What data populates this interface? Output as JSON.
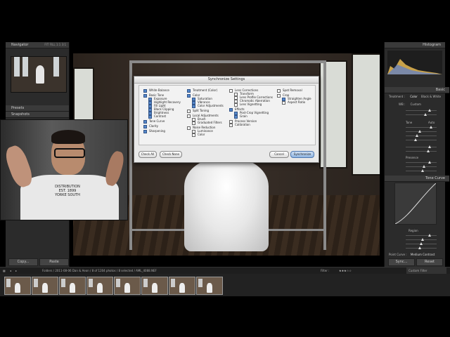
{
  "left_panel": {
    "navigator": {
      "title": "Navigator",
      "zoom_options": [
        "FIT",
        "FILL",
        "1:1",
        "3:1"
      ]
    },
    "presets": "Presets",
    "snapshots": "Snapshots",
    "copy_label": "Copy...",
    "paste_label": "Paste"
  },
  "right_panel": {
    "histogram_title": "Histogram",
    "basic_title": "Basic",
    "treatment": {
      "label": "Treatment :",
      "color": "Color",
      "bw": "Black & White"
    },
    "wb": {
      "label": "WB :",
      "value": "Custom"
    },
    "tone_label": "Tone",
    "auto_label": "Auto",
    "presence_label": "Presence",
    "tone_curve_title": "Tone Curve",
    "region_label": "Region",
    "point_curve": {
      "label": "Point Curve :",
      "value": "Medium Contrast"
    },
    "sync_label": "Sync...",
    "reset_label": "Reset"
  },
  "dialog": {
    "title": "Synchronize Settings",
    "col1": [
      {
        "label": "White Balance",
        "checked": true,
        "indent": false
      },
      {
        "label": "Basic Tone",
        "checked": true,
        "indent": false,
        "gap": true
      },
      {
        "label": "Exposure",
        "checked": true,
        "indent": true
      },
      {
        "label": "Highlight Recovery",
        "checked": true,
        "indent": true
      },
      {
        "label": "Fill Light",
        "checked": true,
        "indent": true
      },
      {
        "label": "Black Clipping",
        "checked": true,
        "indent": true
      },
      {
        "label": "Brightness",
        "checked": true,
        "indent": true
      },
      {
        "label": "Contrast",
        "checked": true,
        "indent": true
      },
      {
        "label": "Tone Curve",
        "checked": true,
        "indent": false,
        "gap": true
      },
      {
        "label": "Clarity",
        "checked": true,
        "indent": false,
        "gap": true
      },
      {
        "label": "Sharpening",
        "checked": true,
        "indent": false,
        "gap": true
      }
    ],
    "col2": [
      {
        "label": "Treatment (Color)",
        "checked": true,
        "indent": false
      },
      {
        "label": "Color",
        "checked": true,
        "indent": false,
        "gap": true
      },
      {
        "label": "Saturation",
        "checked": true,
        "indent": true
      },
      {
        "label": "Vibrance",
        "checked": true,
        "indent": true
      },
      {
        "label": "Color Adjustments",
        "checked": true,
        "indent": true
      },
      {
        "label": "Split Toning",
        "checked": false,
        "indent": false,
        "gap": true
      },
      {
        "label": "Local Adjustments",
        "checked": false,
        "indent": false,
        "gap": true
      },
      {
        "label": "Brush",
        "checked": false,
        "indent": true
      },
      {
        "label": "Graduated Filters",
        "checked": false,
        "indent": true
      },
      {
        "label": "Noise Reduction",
        "checked": false,
        "indent": false,
        "gap": true
      },
      {
        "label": "Luminance",
        "checked": false,
        "indent": true
      },
      {
        "label": "Color",
        "checked": false,
        "indent": true
      }
    ],
    "col3": [
      {
        "label": "Lens Corrections",
        "checked": false,
        "indent": false
      },
      {
        "label": "Transform",
        "checked": false,
        "indent": true
      },
      {
        "label": "Lens Profile Corrections",
        "checked": false,
        "indent": true
      },
      {
        "label": "Chromatic Aberration",
        "checked": false,
        "indent": true
      },
      {
        "label": "Lens Vignetting",
        "checked": false,
        "indent": true
      },
      {
        "label": "Effects",
        "checked": true,
        "indent": false,
        "gap": true
      },
      {
        "label": "Post-Crop Vignetting",
        "checked": true,
        "indent": true
      },
      {
        "label": "Grain",
        "checked": true,
        "indent": true
      },
      {
        "label": "Process Version",
        "checked": false,
        "indent": false,
        "gap": true
      },
      {
        "label": "Calibration",
        "checked": false,
        "indent": false
      }
    ],
    "col4": [
      {
        "label": "Spot Removal",
        "checked": false,
        "indent": false
      },
      {
        "label": "Crop",
        "checked": false,
        "indent": false,
        "gap": true
      },
      {
        "label": "Straighten Angle",
        "checked": true,
        "indent": true
      },
      {
        "label": "Aspect Ratio",
        "checked": false,
        "indent": true
      }
    ],
    "check_all": "Check All",
    "check_none": "Check None",
    "cancel": "Cancel",
    "synchronize": "Synchronize"
  },
  "webcam": {
    "shirt_text": [
      "DISTRIBUTION",
      "EST. 1899",
      "YORKE SOUTH"
    ]
  },
  "filmbar": {
    "path": "Folders / 2011-08-06 Dan & Aeon / 8 of 1204 photos / 8 selected / AML_4088.NEF",
    "filter_label": "Filter :",
    "custom_filter": "Custom Filter"
  }
}
